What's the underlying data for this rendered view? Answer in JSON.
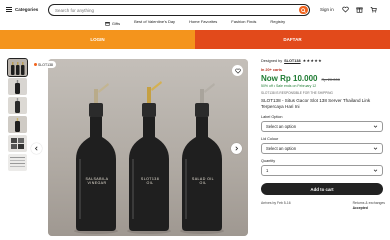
{
  "header": {
    "categories_label": "Categories",
    "search_placeholder": "Search for anything",
    "signin_label": "Sign in"
  },
  "nav": {
    "items": [
      {
        "label": "Gifts"
      },
      {
        "label": "Best of Valentine's Day"
      },
      {
        "label": "Home Favorites"
      },
      {
        "label": "Fashion Finds"
      },
      {
        "label": "Registry"
      }
    ]
  },
  "auth": {
    "login_label": "LOGIN",
    "register_label": "DAFTAR"
  },
  "gallery": {
    "badge_label": "SLOT138",
    "bottle_labels": [
      "SALSABILA\nVINEGAR",
      "SLOT138\nOIL",
      "SALAD OIL\nOIL"
    ]
  },
  "product": {
    "designed_by_prefix": "Designed by",
    "shop_name": "SLOT138",
    "rating_stars": "★★★★★",
    "stock_note": "In 20+ carts",
    "price": "Now Rp 10.000",
    "old_price": "Rp 20.000",
    "discount_note": "50% off • Sale ends on February 12",
    "shop_line": "SLOT138 IS RESPONSIBLE FOR THE SHIPPING",
    "title": "SLOT138 - Situs Gacor Slot 138 Server Thailand Link Terpercaya Hari Ini",
    "label_option": {
      "label": "Label Option",
      "value": "Select an option"
    },
    "lid_colour": {
      "label": "Lid Colour",
      "value": "Select an option"
    },
    "quantity": {
      "label": "Quantity",
      "value": "1"
    },
    "add_to_cart_label": "Add to cart",
    "arrives_by": "Arrives by Feb 5-16",
    "returns_label": "Returns & exchanges",
    "returns_value": "Accepted"
  },
  "colors": {
    "accent": "#f1641e",
    "login_bg": "#f4941c",
    "register_bg": "#e24a1b",
    "price": "#1e7b32"
  }
}
